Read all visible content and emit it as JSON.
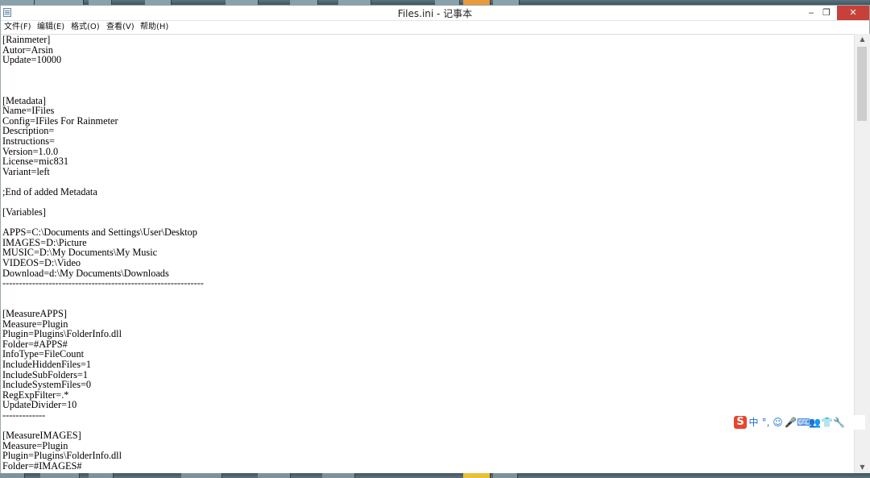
{
  "window": {
    "title": "Files.ini - 记事本",
    "minimize_glyph": "‒",
    "restore_glyph": "❐",
    "close_glyph": "✕"
  },
  "menu": [
    "文件(F)",
    "编辑(E)",
    "格式(O)",
    "查看(V)",
    "帮助(H)"
  ],
  "editor": {
    "lines": [
      "[Rainmeter]",
      "Autor=Arsin",
      "Update=10000",
      "",
      "",
      "",
      "[Metadata]",
      "Name=IFiles",
      "Config=IFiles For Rainmeter",
      "Description=",
      "Instructions=",
      "Version=1.0.0",
      "License=mic831",
      "Variant=left",
      "",
      ";End of added Metadata",
      "",
      "[Variables]",
      "",
      "APPS=C:\\Documents and Settings\\User\\Desktop",
      "IMAGES=D:\\Picture",
      "MUSIC=D:\\My Documents\\My Music",
      "VIDEOS=D:\\Video",
      "Download=d:\\My Documents\\Downloads",
      "-------------------------------------------------------------",
      "",
      "",
      "[MeasureAPPS]",
      "Measure=Plugin",
      "Plugin=Plugins\\FolderInfo.dll",
      "Folder=#APPS#",
      "InfoType=FileCount",
      "IncludeHiddenFiles=1",
      "IncludeSubFolders=1",
      "IncludeSystemFiles=0",
      "RegExpFilter=.*",
      "UpdateDivider=10",
      "-------------",
      "",
      "[MeasureIMAGES]",
      "Measure=Plugin",
      "Plugin=Plugins\\FolderInfo.dll",
      "Folder=#IMAGES#"
    ]
  },
  "scrollbar": {
    "up_glyph": "▲",
    "down_glyph": "▼"
  },
  "ime_toolbar": {
    "logo": "S",
    "items": [
      "中",
      "°,",
      "☺",
      "🎤",
      "⌨",
      "👥",
      "👕",
      "🔧"
    ]
  }
}
